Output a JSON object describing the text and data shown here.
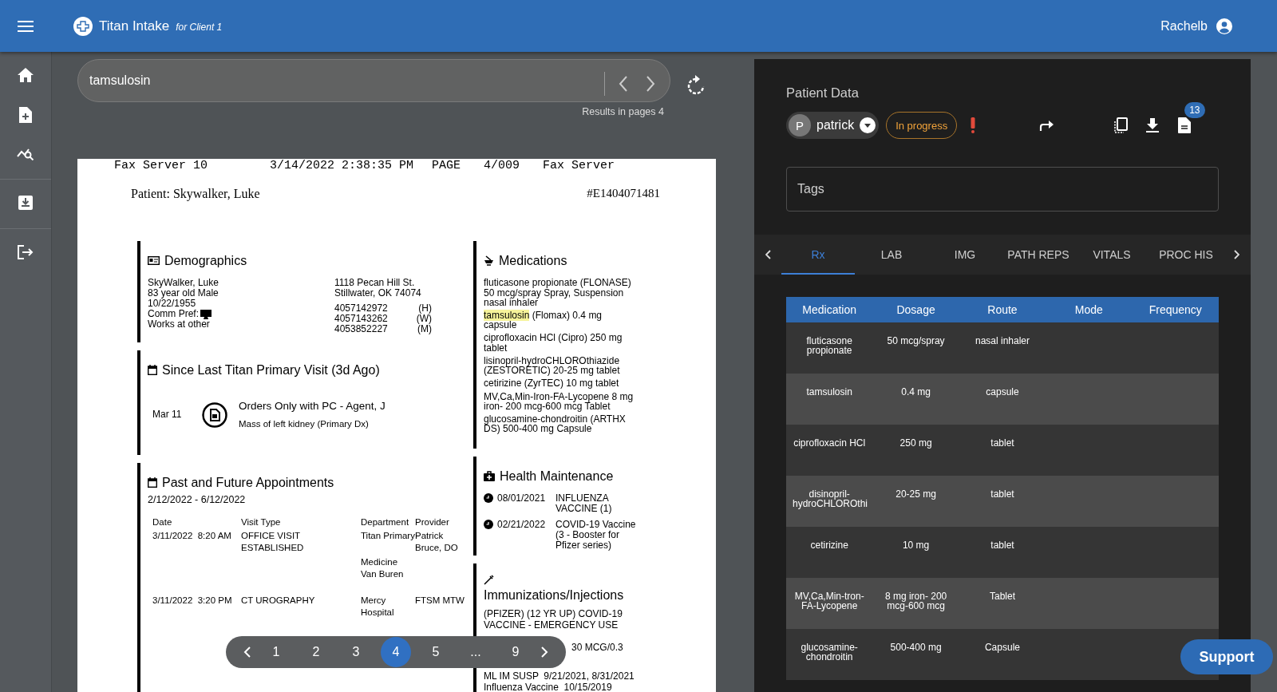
{
  "header": {
    "title": "Titan Intake",
    "subtitle": "for Client 1",
    "user": "Rachelb"
  },
  "sidebar": {
    "items": [
      {
        "kind": "home"
      },
      {
        "kind": "file-add"
      },
      {
        "kind": "chart-search",
        "divider_after": true
      },
      {
        "kind": "download",
        "divider_after": true
      },
      {
        "kind": "logout"
      }
    ]
  },
  "search": {
    "value": "tamsulosin",
    "results": "Results in pages 4"
  },
  "document": {
    "fax_header": [
      "Fax Server 10",
      "3/14/2022 2:38:35 PM",
      "PAGE",
      "4/009",
      "Fax Server"
    ],
    "patient": "Patient: Skywalker, Luke",
    "record_number": "#E1404071481",
    "demographics": {
      "title": "Demographics",
      "lines": [
        "SkyWalker, Luke",
        "83 year old Male",
        "10/22/1955",
        "Comm Pref:",
        "Works at other"
      ],
      "address": [
        "1118 Pecan Hill St.",
        "Stillwater, OK 74074"
      ],
      "phones": [
        {
          "number": "4057142972",
          "type": "(H)"
        },
        {
          "number": "4057143262",
          "type": "(W)"
        },
        {
          "number": "4053852227",
          "type": "(M)"
        }
      ]
    },
    "since_last": {
      "title": "Since Last Titan Primary Visit (3d Ago)",
      "date": "Mar 11",
      "order": "Orders Only with PC - Agent, J",
      "diagnosis": "Mass of left kidney (Primary Dx)"
    },
    "appointments": {
      "title": "Past and Future Appointments",
      "range": "2/12/2022 - 6/12/2022",
      "columns": [
        "Date",
        "Visit Type",
        "Department",
        "Provider"
      ],
      "rows": [
        {
          "date": "3/11/2022  8:20 AM",
          "visit_type": "OFFICE VISIT ESTABLISHED",
          "department": [
            "Titan Primary",
            "Medicine Van Buren"
          ],
          "provider": "Patrick Bruce, DO"
        },
        {
          "date": "3/11/2022  3:20 PM",
          "visit_type": "CT UROGRAPHY",
          "department": [
            "Mercy Hospital"
          ],
          "provider": "FTSM MTW"
        }
      ]
    },
    "medications": {
      "title": "Medications",
      "items": [
        {
          "segments": [
            {
              "text": "fluticasone propionate (FLONASE) 50 mcg/spray Spray, Suspension nasal inhaler",
              "highlighted": false
            }
          ]
        },
        {
          "segments": [
            {
              "text": "tamsulosin",
              "highlighted": true
            },
            {
              "text": " (Flomax) 0.4 mg capsule",
              "highlighted": false
            }
          ]
        },
        {
          "segments": [
            {
              "text": "ciprofloxacin HCl (Cipro) 250 mg tablet",
              "highlighted": false
            }
          ]
        },
        {
          "segments": [
            {
              "text": "lisinopril-hydroCHLOROthiazide (ZESTORETIC) 20-25 mg tablet",
              "highlighted": false
            }
          ]
        },
        {
          "segments": [
            {
              "text": "cetirizine (ZyrTEC) 10 mg tablet",
              "highlighted": false
            }
          ]
        },
        {
          "segments": [
            {
              "text": "MV,Ca,Min-Iron-FA-Lycopene 8 mg iron- 200 mcg-600 mcg Tablet",
              "highlighted": false
            }
          ]
        },
        {
          "segments": [
            {
              "text": "glucosamine-chondroitin (ARTHX DS) 500-400 mg Capsule",
              "highlighted": false
            }
          ]
        }
      ]
    },
    "health_maintenance": {
      "title": "Health Maintenance",
      "items": [
        {
          "date": "08/01/2021",
          "text": "INFLUENZA VACCINE (1)"
        },
        {
          "date": "02/21/2022",
          "text": "COVID-19 Vaccine (3 - Booster for Pfizer series)"
        }
      ]
    },
    "immunizations": {
      "title": "Immunizations/Injections",
      "lines_above": [
        "(PFIZER) (12 YR UP) COVID-19",
        "VACCINE - EMERGENCY USE"
      ],
      "partial_line": "30 MCG/0.3",
      "lines_below": [
        "ML IM SUSP  9/21/2021, 8/31/2021",
        "Influenza Vaccine  10/15/2019"
      ]
    }
  },
  "pagination": {
    "pages": [
      {
        "label": "1",
        "selected": false
      },
      {
        "label": "2",
        "selected": false
      },
      {
        "label": "3",
        "selected": false
      },
      {
        "label": "4",
        "selected": true
      },
      {
        "label": "5",
        "selected": false
      },
      {
        "label": "...",
        "selected": false
      },
      {
        "label": "9",
        "selected": false
      }
    ]
  },
  "patient_panel": {
    "title": "Patient Data",
    "assignee": {
      "initial": "P",
      "name": "patrick"
    },
    "status": "In progress",
    "badge": "13",
    "tags": {
      "placeholder": "Tags"
    },
    "tabs": [
      {
        "label": "Rx",
        "selected": true
      },
      {
        "label": "LAB",
        "selected": false
      },
      {
        "label": "IMG",
        "selected": false
      },
      {
        "label": "PATH REPS",
        "selected": false
      },
      {
        "label": "VITALS",
        "selected": false
      },
      {
        "label": "PROC HIS",
        "selected": false
      }
    ],
    "table": {
      "columns": [
        "Medication",
        "Dosage",
        "Route",
        "Mode",
        "Frequency"
      ],
      "rows": [
        {
          "medication": "fluticasone propionate",
          "dosage": "50 mcg/spray",
          "route": "nasal inhaler"
        },
        {
          "medication": "tamsulosin",
          "dosage": "0.4 mg",
          "route": "capsule"
        },
        {
          "medication": "ciprofloxacin HCl",
          "dosage": "250 mg",
          "route": "tablet"
        },
        {
          "medication": "disinopril-hydroCHLOROthi",
          "dosage": "20-25 mg",
          "route": "tablet"
        },
        {
          "medication": "cetirizine",
          "dosage": "10 mg",
          "route": "tablet"
        },
        {
          "medication": "MV,Ca,Min-tron-FA-Lycopene",
          "dosage": "8 mg iron- 200 mcg-600 mcg",
          "route": "Tablet"
        },
        {
          "medication": "glucosamine-chondroitin",
          "dosage": "500-400 mg",
          "route": "Capsule"
        }
      ]
    }
  },
  "support_button": "Support"
}
